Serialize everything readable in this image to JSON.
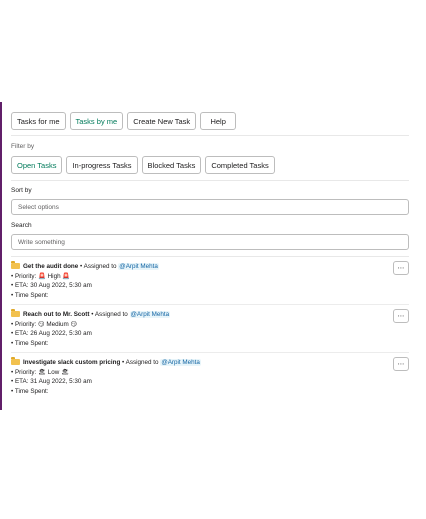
{
  "top_buttons": [
    {
      "label": "Tasks for me"
    },
    {
      "label": "Tasks by me"
    },
    {
      "label": "Create New Task"
    },
    {
      "label": "Help"
    }
  ],
  "filter": {
    "label": "Filter by",
    "options": [
      {
        "label": "Open Tasks"
      },
      {
        "label": "In-progress Tasks"
      },
      {
        "label": "Blocked Tasks"
      },
      {
        "label": "Completed Tasks"
      }
    ]
  },
  "sort": {
    "label": "Sort by",
    "placeholder": "Select options"
  },
  "search": {
    "label": "Search",
    "placeholder": "Write something"
  },
  "tasks": [
    {
      "title": "Get the audit done",
      "assigned_prefix": " • Assigned to ",
      "assignee": "@Arpit Mehta",
      "priority_label": "• Priority: ",
      "priority": "🚨 High 🚨",
      "eta_label": "• ETA: ",
      "eta": "30 Aug 2022, 5:30 am",
      "time_spent_label": "• Time Spent:"
    },
    {
      "title": "Reach out to Mr. Scott",
      "assigned_prefix": " • Assigned to ",
      "assignee": "@Arpit Mehta",
      "priority_label": "• Priority: ",
      "priority": "😏 Medium 😏",
      "eta_label": "• ETA: ",
      "eta": "26 Aug 2022, 5:30 am",
      "time_spent_label": "• Time Spent:"
    },
    {
      "title": "Investigate slack custom pricing",
      "assigned_prefix": " • Assigned to ",
      "assignee": "@Arpit Mehta",
      "priority_label": "• Priority: ",
      "priority": "🏖 Low 🏖",
      "eta_label": "• ETA: ",
      "eta": "31 Aug 2022, 5:30 am",
      "time_spent_label": "• Time Spent:"
    }
  ],
  "more_button": "⋯",
  "colors": {
    "accent_green": "#007a5a",
    "mention_blue": "#1264a3",
    "sidebar": "#611f69"
  }
}
